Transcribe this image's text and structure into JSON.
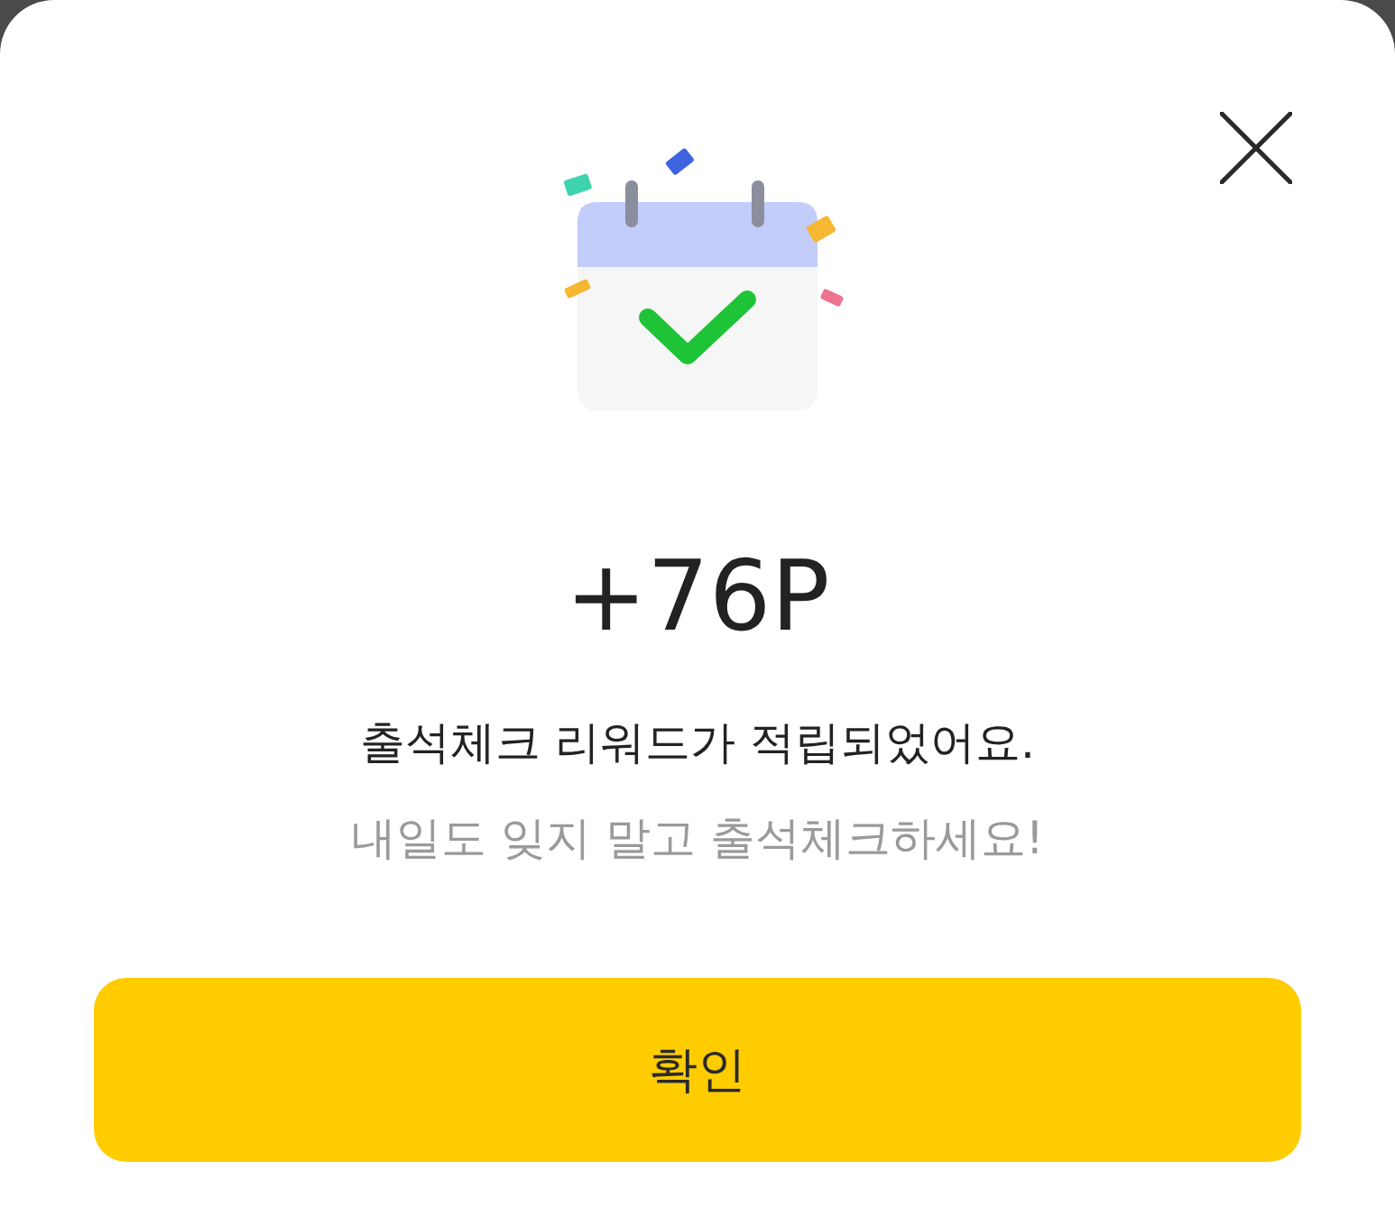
{
  "reward": {
    "points": "+76P",
    "message": "출석체크 리워드가 적립되었어요.",
    "subtext": "내일도 잊지 말고 출석체크하세요!"
  },
  "button": {
    "label": "확인"
  }
}
